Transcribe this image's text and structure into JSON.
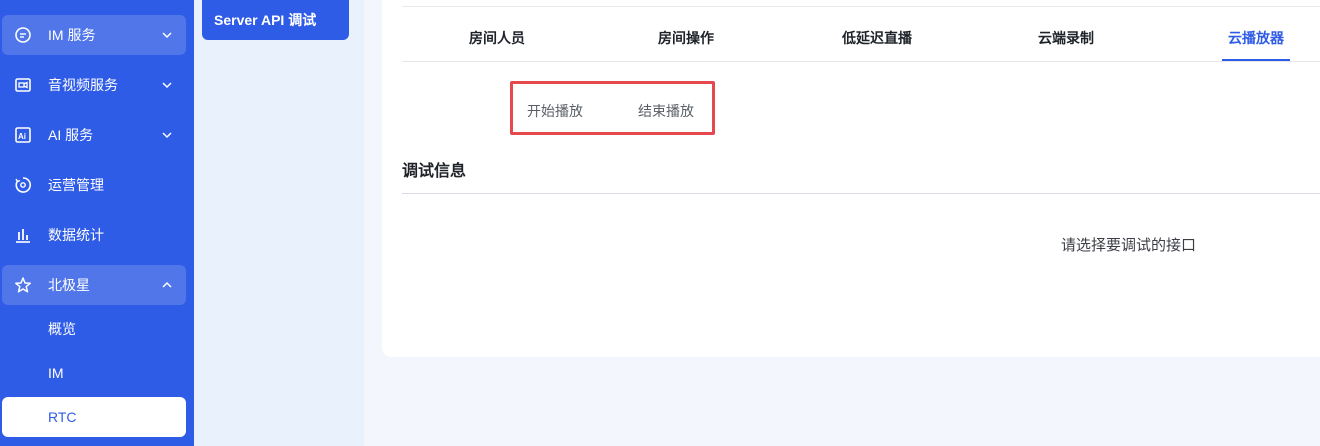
{
  "sidebar": {
    "items": [
      {
        "label": "IM 服务",
        "icon": "chat-icon",
        "expanded": false
      },
      {
        "label": "音视频服务",
        "icon": "video-icon",
        "expanded": false
      },
      {
        "label": "AI 服务",
        "icon": "ai-icon",
        "expanded": false
      },
      {
        "label": "运营管理",
        "icon": "operations-icon"
      },
      {
        "label": "数据统计",
        "icon": "bar-chart-icon"
      },
      {
        "label": "北极星",
        "icon": "star-icon",
        "expanded": true
      }
    ],
    "sub_items": [
      {
        "label": "概览"
      },
      {
        "label": "IM"
      },
      {
        "label": "RTC",
        "selected": true
      }
    ],
    "colors": {
      "background": "#2f5ce6",
      "selected_text": "#2f5ce6"
    }
  },
  "subnav": {
    "button_label": "Server API 调试"
  },
  "main": {
    "tabs": [
      {
        "label": "房间人员"
      },
      {
        "label": "房间操作"
      },
      {
        "label": "低延迟直播"
      },
      {
        "label": "云端录制"
      },
      {
        "label": "云播放器",
        "active": true
      }
    ],
    "subtabs": [
      {
        "label": "开始播放"
      },
      {
        "label": "结束播放"
      }
    ],
    "debug_title": "调试信息",
    "empty_message": "请选择要调试的接口",
    "accent_color": "#2f5ce6",
    "highlight_color": "#e5484d"
  }
}
